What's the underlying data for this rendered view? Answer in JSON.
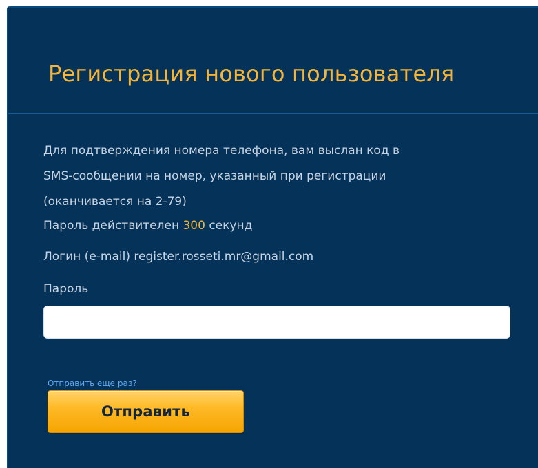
{
  "form": {
    "title": "Регистрация нового пользователя",
    "message_line_1": "Для подтверждения номера телефона, вам выслан код в",
    "message_line_2": "SMS-сообщении на номер, указанный при регистрации",
    "message_line_3": "(оканчивается на 2-79)",
    "password_validity_prefix": "Пароль действителен",
    "password_validity_seconds": "300",
    "password_validity_suffix": "секунд",
    "login_label": "Логин (e-mail)",
    "login_value": "register.rosseti.mr@gmail.com",
    "password_label": "Пароль",
    "password_value": "",
    "password_placeholder": "",
    "resend_link": "Отправить еще раз?",
    "submit_button": "Отправить"
  },
  "colors": {
    "panel_background": "#053258",
    "title": "#f2b43a",
    "text": "#c8d4e3",
    "link": "#5da9f4",
    "button": "#ffba28"
  }
}
